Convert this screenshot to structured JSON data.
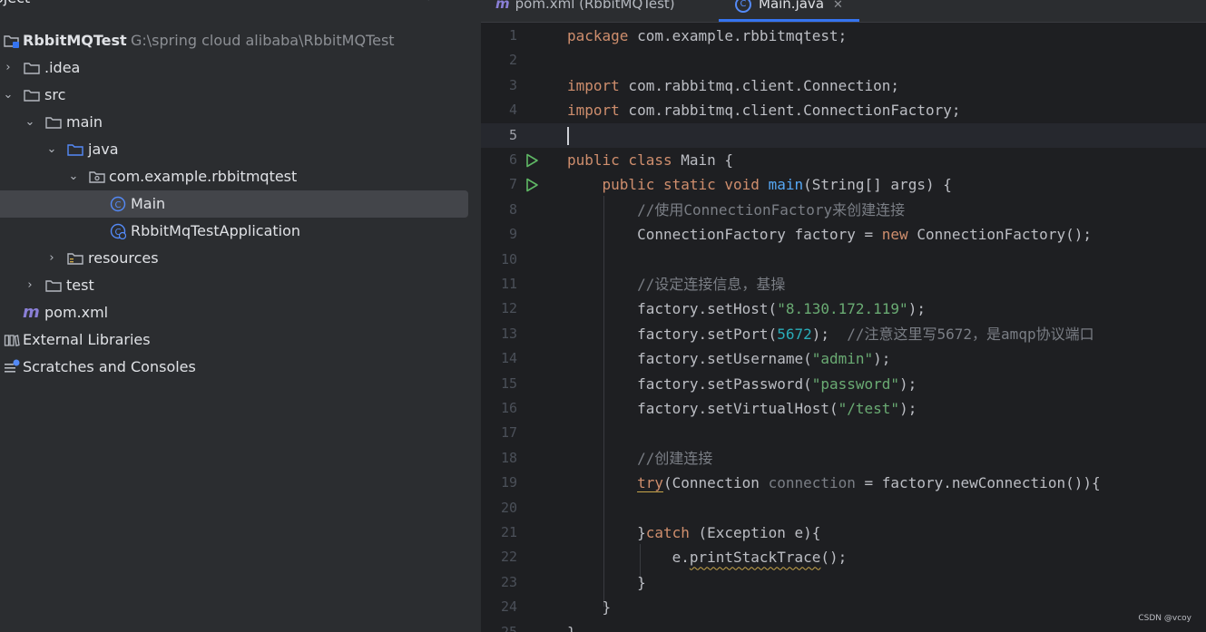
{
  "project_panel": {
    "title": "oject",
    "tree": [
      {
        "label": "RbbitMQTest",
        "path": "G:\\spring cloud alibaba\\RbbitMQTest"
      },
      {
        "label": ".idea"
      },
      {
        "label": "src"
      },
      {
        "label": "main"
      },
      {
        "label": "java"
      },
      {
        "label": "com.example.rbbitmqtest"
      },
      {
        "label": "Main"
      },
      {
        "label": "RbbitMqTestApplication"
      },
      {
        "label": "resources"
      },
      {
        "label": "test"
      },
      {
        "label": "pom.xml"
      },
      {
        "label": "External Libraries"
      },
      {
        "label": "Scratches and Consoles"
      }
    ]
  },
  "tabs": [
    {
      "label": "pom.xml (RbbitMQTest)",
      "icon": "m"
    },
    {
      "label": "Main.java",
      "icon": "c",
      "active": true
    }
  ],
  "editor": {
    "current_line": 5,
    "lines": [
      "package com.example.rbbitmqtest;",
      "",
      "import com.rabbitmq.client.Connection;",
      "import com.rabbitmq.client.ConnectionFactory;",
      "",
      "public class Main {",
      "    public static void main(String[] args) {",
      "        //使用ConnectionFactory来创建连接",
      "        ConnectionFactory factory = new ConnectionFactory();",
      "",
      "        //设定连接信息，基操",
      "        factory.setHost(\"8.130.172.119\");",
      "        factory.setPort(5672);  //注意这里写5672，是amqp协议端口",
      "        factory.setUsername(\"admin\");",
      "        factory.setPassword(\"password\");",
      "        factory.setVirtualHost(\"/test\");",
      "",
      "        //创建连接",
      "        try(Connection connection = factory.newConnection()){",
      "",
      "        }catch (Exception e){",
      "            e.printStackTrace();",
      "        }",
      "    }",
      "}"
    ]
  },
  "watermark": "CSDN @vcoy",
  "colors": {
    "keyword": "#cf8e6d",
    "string": "#6aab73",
    "number": "#2aacb8",
    "comment": "#7a7e85",
    "method": "#56a8f5",
    "accent": "#3574f0"
  }
}
